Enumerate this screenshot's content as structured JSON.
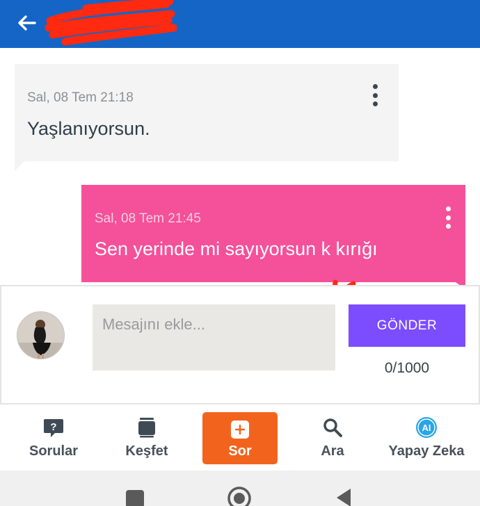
{
  "header": {
    "back_icon": "arrow-left-icon",
    "title_redacted": true,
    "bg_color": "#1565c6"
  },
  "messages": [
    {
      "direction": "incoming",
      "timestamp": "Sal, 08 Tem 21:18",
      "text": "Yaşlanıyorsun.",
      "bubble_color": "#f4f4f4"
    },
    {
      "direction": "outgoing",
      "timestamp": "Sal, 08 Tem 21:45",
      "text": "Sen yerinde mi sayıyorsun  k kırığı",
      "bubble_color": "#f5509a"
    }
  ],
  "composer": {
    "placeholder": "Mesajını ekle...",
    "value": "",
    "send_label": "GÖNDER",
    "counter": "0/1000",
    "send_color": "#7c4dff"
  },
  "bottom_nav": {
    "items": [
      {
        "label": "Sorular",
        "icon": "question-bubble-icon"
      },
      {
        "label": "Keşfet",
        "icon": "cards-stack-icon"
      },
      {
        "label": "Sor",
        "icon": "plus-square-icon",
        "active_color": "#f2641e"
      },
      {
        "label": "Ara",
        "icon": "search-icon"
      },
      {
        "label": "Yapay Zeka",
        "icon": "ai-badge-icon"
      }
    ]
  },
  "system_nav": {
    "icons": [
      "recents-square-icon",
      "home-circle-icon",
      "back-triangle-icon"
    ]
  }
}
